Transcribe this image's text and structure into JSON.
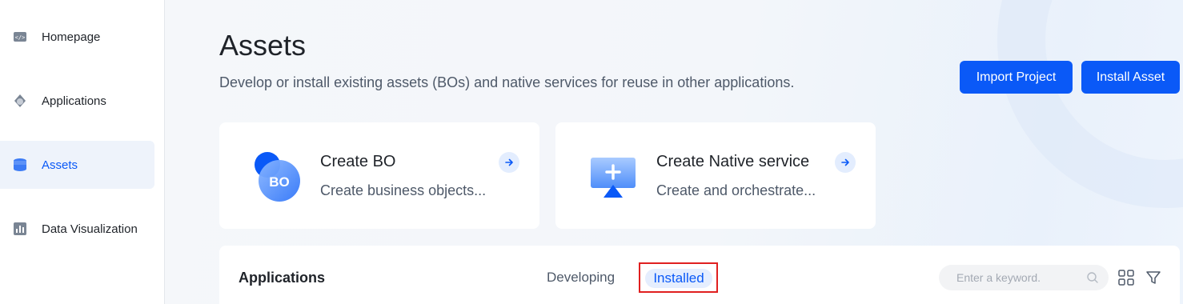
{
  "sidebar": {
    "items": [
      {
        "label": "Homepage",
        "icon": "code-icon"
      },
      {
        "label": "Applications",
        "icon": "applications-icon"
      },
      {
        "label": "Assets",
        "icon": "database-icon",
        "active": true
      },
      {
        "label": "Data Visualization",
        "icon": "bar-chart-icon"
      }
    ]
  },
  "header": {
    "title": "Assets",
    "description": "Develop or install existing assets (BOs) and native services for reuse in other applications.",
    "import_label": "Import Project",
    "install_label": "Install Asset"
  },
  "cards": [
    {
      "title": "Create BO",
      "description": "Create business objects...",
      "icon_text": "BO"
    },
    {
      "title": "Create Native service",
      "description": "Create and orchestrate..."
    }
  ],
  "panel": {
    "title": "Applications",
    "tabs": [
      {
        "label": "Developing"
      },
      {
        "label": "Installed",
        "selected": true
      }
    ],
    "search_placeholder": "Enter a keyword."
  },
  "colors": {
    "accent": "#0a59f7",
    "highlight_box": "#e02020"
  }
}
